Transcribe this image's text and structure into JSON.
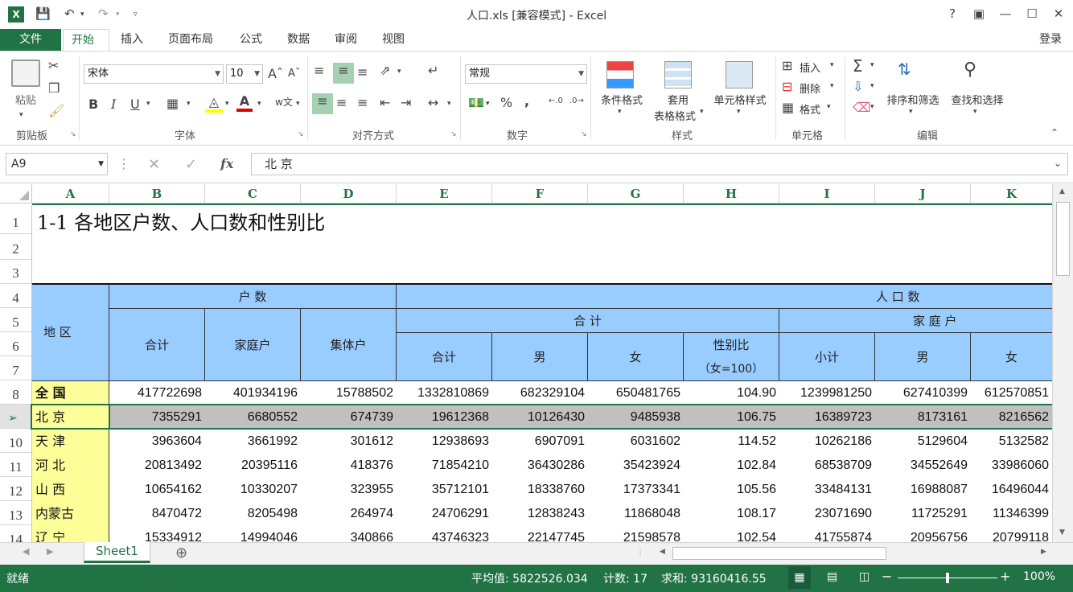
{
  "window": {
    "title": "人口.xls  [兼容模式] - Excel",
    "help": "?",
    "login": "登录"
  },
  "tabs": [
    "文件",
    "开始",
    "插入",
    "页面布局",
    "公式",
    "数据",
    "审阅",
    "视图"
  ],
  "ribbon": {
    "clipboard": {
      "paste": "粘贴",
      "label": "剪贴板"
    },
    "font": {
      "name": "宋体",
      "size": "10",
      "bold": "B",
      "italic": "I",
      "underline": "U",
      "label": "字体"
    },
    "alignment": {
      "label": "对齐方式"
    },
    "number": {
      "format": "常规",
      "percent": "%",
      "comma": ",",
      "label": "数字"
    },
    "styles": {
      "conditional": "条件格式",
      "table_line1": "套用",
      "table_line2": "表格格式",
      "cell": "单元格样式",
      "label": "样式"
    },
    "cells": {
      "insert": "插入",
      "delete": "删除",
      "format": "格式",
      "label": "单元格"
    },
    "editing": {
      "sort": "排序和筛选",
      "find": "查找和选择",
      "label": "编辑"
    }
  },
  "formula_bar": {
    "name_box": "A9",
    "fx": "fx",
    "value": "北    京"
  },
  "columns": [
    "A",
    "B",
    "C",
    "D",
    "E",
    "F",
    "G",
    "H",
    "I",
    "J",
    "K"
  ],
  "rows": [
    "1",
    "2",
    "3",
    "4",
    "5",
    "6",
    "7",
    "8",
    "9",
    "10",
    "11",
    "12",
    "13",
    "14"
  ],
  "sheet": {
    "title": "1-1  各地区户数、人口数和性别比",
    "header": {
      "region": "地    区",
      "households": "户          数",
      "population": "人          口          数",
      "total": "合          计",
      "family_households": "家        庭        户",
      "hh_total": "合计",
      "hh_family": "家庭户",
      "hh_collective": "集体户",
      "p_total": "合计",
      "p_male": "男",
      "p_female": "女",
      "sex_ratio": "性别比",
      "sex_ratio_note": "（女=100）",
      "f_subtotal": "小计",
      "f_male": "男",
      "f_female": "女"
    },
    "data": [
      {
        "region": "全    国",
        "b": "417722698",
        "c": "401934196",
        "d": "15788502",
        "e": "1332810869",
        "f": "682329104",
        "g": "650481765",
        "h": "104.90",
        "i": "1239981250",
        "j": "627410399",
        "k": "612570851"
      },
      {
        "region": "北    京",
        "b": "7355291",
        "c": "6680552",
        "d": "674739",
        "e": "19612368",
        "f": "10126430",
        "g": "9485938",
        "h": "106.75",
        "i": "16389723",
        "j": "8173161",
        "k": "8216562"
      },
      {
        "region": "天    津",
        "b": "3963604",
        "c": "3661992",
        "d": "301612",
        "e": "12938693",
        "f": "6907091",
        "g": "6031602",
        "h": "114.52",
        "i": "10262186",
        "j": "5129604",
        "k": "5132582"
      },
      {
        "region": "河    北",
        "b": "20813492",
        "c": "20395116",
        "d": "418376",
        "e": "71854210",
        "f": "36430286",
        "g": "35423924",
        "h": "102.84",
        "i": "68538709",
        "j": "34552649",
        "k": "33986060"
      },
      {
        "region": "山    西",
        "b": "10654162",
        "c": "10330207",
        "d": "323955",
        "e": "35712101",
        "f": "18338760",
        "g": "17373341",
        "h": "105.56",
        "i": "33484131",
        "j": "16988087",
        "k": "16496044"
      },
      {
        "region": "内蒙古",
        "b": "8470472",
        "c": "8205498",
        "d": "264974",
        "e": "24706291",
        "f": "12838243",
        "g": "11868048",
        "h": "108.17",
        "i": "23071690",
        "j": "11725291",
        "k": "11346399"
      },
      {
        "region": "辽    宁",
        "b": "15334912",
        "c": "14994046",
        "d": "340866",
        "e": "43746323",
        "f": "22147745",
        "g": "21598578",
        "h": "102.54",
        "i": "41755874",
        "j": "20956756",
        "k": "20799118"
      }
    ]
  },
  "sheet_tabs": {
    "active": "Sheet1",
    "add": "⊕"
  },
  "status": {
    "ready": "就绪",
    "average": "平均值: 5822526.034",
    "count": "计数: 17",
    "sum": "求和: 93160416.55",
    "zoom": "100%"
  },
  "colors": {
    "accent": "#217346",
    "header_fill": "#99ccff",
    "region_fill": "#ffff99",
    "selected_row": "#c0c0c0"
  }
}
